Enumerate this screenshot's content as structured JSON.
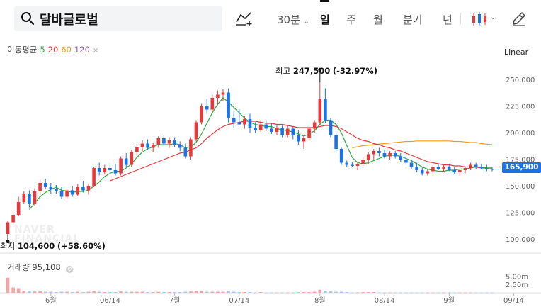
{
  "search": {
    "query": "달바글로벌"
  },
  "periods": [
    {
      "label": "30분",
      "has_dropdown": true
    },
    {
      "label": "일",
      "active": true
    },
    {
      "label": "주"
    },
    {
      "label": "월"
    },
    {
      "label": "분기"
    },
    {
      "label": "년"
    }
  ],
  "toolbar": {
    "dropdown_chevron": "⌄"
  },
  "ma_legend": {
    "title": "이동평균",
    "p5": "5",
    "p20": "20",
    "p60": "60",
    "p120": "120",
    "close": "×"
  },
  "colors": {
    "ma5": "#2eaa3c",
    "ma20": "#e8383b",
    "ma60": "#f39c12",
    "ma120": "#9b59b6",
    "up": "#e8383b",
    "down": "#1a73e8"
  },
  "scale_mode": "Linear",
  "annotations": {
    "high_prefix": "최고",
    "high_value": "247,500",
    "high_change": "(-32.97%)",
    "low_prefix": "최저",
    "low_value": "104,600",
    "low_change": "(+58.60%)"
  },
  "current_price": "165,900",
  "watermark": {
    "line1": "NAVER",
    "line2": "FINANCIAL"
  },
  "volume": {
    "title": "거래량",
    "value": "95,108",
    "gear": "⚙"
  },
  "chart_data": {
    "type": "candlestick",
    "y_ticks": [
      "250,000",
      "225,000",
      "200,000",
      "175,000",
      "150,000",
      "125,000",
      "100,000"
    ],
    "y_tick_values": [
      250000,
      225000,
      200000,
      175000,
      150000,
      125000,
      100000
    ],
    "ylim": [
      87000,
      265000
    ],
    "volume_ticks": [
      "5.00m",
      "2.50m"
    ],
    "volume_tick_values": [
      5.0,
      2.5
    ],
    "vol_max": 5.6,
    "x_labels": [
      "6월",
      "06/14",
      "7월",
      "07/14",
      "8월",
      "08/14",
      "9월",
      "09/14"
    ],
    "x_label_index": [
      8,
      19,
      31,
      43,
      58,
      70,
      82,
      94
    ],
    "high": 247500,
    "low": 104600,
    "last": 165900,
    "ohlc": [
      [
        105000,
        117000,
        104600,
        116000,
        4.6
      ],
      [
        116000,
        125000,
        115000,
        123000,
        1.6
      ],
      [
        123000,
        140000,
        122000,
        135000,
        1.4
      ],
      [
        135000,
        145000,
        133000,
        143000,
        0.6
      ],
      [
        143000,
        146000,
        130000,
        133000,
        0.6
      ],
      [
        133000,
        148000,
        131000,
        145000,
        0.4
      ],
      [
        145000,
        156000,
        143000,
        153000,
        0.4
      ],
      [
        153000,
        157000,
        147000,
        149000,
        0.3
      ],
      [
        149000,
        153000,
        143000,
        147000,
        0.3
      ],
      [
        147000,
        151000,
        143000,
        145000,
        0.2
      ],
      [
        145000,
        149000,
        138000,
        140000,
        0.3
      ],
      [
        140000,
        148000,
        138000,
        146000,
        0.3
      ],
      [
        146000,
        150000,
        140000,
        142000,
        0.2
      ],
      [
        142000,
        152000,
        141000,
        149000,
        0.3
      ],
      [
        149000,
        155000,
        144000,
        146000,
        0.2
      ],
      [
        146000,
        152000,
        142000,
        150000,
        0.3
      ],
      [
        150000,
        168000,
        149000,
        167000,
        0.6
      ],
      [
        167000,
        172000,
        160000,
        163000,
        0.3
      ],
      [
        163000,
        170000,
        161000,
        167000,
        0.2
      ],
      [
        167000,
        172000,
        162000,
        165000,
        0.2
      ],
      [
        165000,
        171000,
        160000,
        162000,
        0.2
      ],
      [
        162000,
        178000,
        160000,
        176000,
        0.4
      ],
      [
        176000,
        181000,
        168000,
        170000,
        0.3
      ],
      [
        170000,
        184000,
        168000,
        182000,
        0.3
      ],
      [
        182000,
        189000,
        178000,
        187000,
        0.3
      ],
      [
        187000,
        193000,
        183000,
        190000,
        0.3
      ],
      [
        190000,
        194000,
        184000,
        186000,
        0.2
      ],
      [
        186000,
        191000,
        182000,
        189000,
        0.2
      ],
      [
        189000,
        197000,
        186000,
        195000,
        0.3
      ],
      [
        195000,
        198000,
        188000,
        190000,
        0.2
      ],
      [
        190000,
        196000,
        186000,
        193000,
        0.2
      ],
      [
        193000,
        196000,
        187000,
        189000,
        0.2
      ],
      [
        189000,
        192000,
        183000,
        186000,
        0.2
      ],
      [
        186000,
        190000,
        176000,
        178000,
        0.3
      ],
      [
        178000,
        196000,
        175000,
        194000,
        0.4
      ],
      [
        194000,
        212000,
        192000,
        210000,
        0.6
      ],
      [
        210000,
        228000,
        208000,
        225000,
        0.5
      ],
      [
        225000,
        232000,
        218000,
        222000,
        0.3
      ],
      [
        222000,
        236000,
        220000,
        233000,
        0.3
      ],
      [
        233000,
        240000,
        226000,
        236000,
        0.3
      ],
      [
        236000,
        241000,
        230000,
        238000,
        0.3
      ],
      [
        238000,
        242000,
        210000,
        214000,
        0.5
      ],
      [
        214000,
        220000,
        205000,
        210000,
        0.3
      ],
      [
        210000,
        222000,
        207000,
        208000,
        0.2
      ],
      [
        208000,
        216000,
        204000,
        213000,
        0.2
      ],
      [
        213000,
        218000,
        200000,
        205000,
        0.2
      ],
      [
        205000,
        210000,
        200000,
        203000,
        0.1
      ],
      [
        203000,
        212000,
        201000,
        208000,
        0.2
      ],
      [
        208000,
        212000,
        202000,
        204000,
        0.1
      ],
      [
        204000,
        209000,
        199000,
        201000,
        0.1
      ],
      [
        201000,
        207000,
        198000,
        205000,
        0.1
      ],
      [
        205000,
        208000,
        196000,
        198000,
        0.1
      ],
      [
        198000,
        207000,
        196000,
        204000,
        0.1
      ],
      [
        204000,
        206000,
        194000,
        198000,
        0.1
      ],
      [
        198000,
        203000,
        189000,
        192000,
        0.2
      ],
      [
        192000,
        198000,
        185000,
        195000,
        0.2
      ],
      [
        195000,
        206000,
        193000,
        204000,
        0.2
      ],
      [
        204000,
        212000,
        200000,
        210000,
        0.3
      ],
      [
        210000,
        247500,
        207000,
        232000,
        0.9
      ],
      [
        232000,
        242000,
        209000,
        212000,
        0.6
      ],
      [
        212000,
        214000,
        196000,
        198000,
        0.4
      ],
      [
        198000,
        200000,
        182000,
        185000,
        0.3
      ],
      [
        185000,
        186000,
        170000,
        172000,
        0.3
      ],
      [
        172000,
        174000,
        168000,
        170000,
        0.2
      ],
      [
        170000,
        173000,
        168000,
        169000,
        0.1
      ],
      [
        169000,
        173000,
        165000,
        171000,
        0.1
      ],
      [
        171000,
        178000,
        169000,
        175000,
        0.2
      ],
      [
        175000,
        182000,
        171000,
        180000,
        0.2
      ],
      [
        180000,
        185000,
        175000,
        183000,
        0.2
      ],
      [
        183000,
        186000,
        178000,
        181000,
        0.1
      ],
      [
        181000,
        184000,
        176000,
        178000,
        0.1
      ],
      [
        178000,
        183000,
        175000,
        181000,
        0.1
      ],
      [
        181000,
        183000,
        176000,
        178000,
        0.1
      ],
      [
        178000,
        181000,
        173000,
        175000,
        0.1
      ],
      [
        175000,
        178000,
        170000,
        172000,
        0.1
      ],
      [
        172000,
        175000,
        166000,
        168000,
        0.1
      ],
      [
        168000,
        172000,
        163000,
        165000,
        0.1
      ],
      [
        165000,
        168000,
        160000,
        162000,
        0.1
      ],
      [
        162000,
        166000,
        160000,
        164000,
        0.1
      ],
      [
        164000,
        170000,
        162000,
        168000,
        0.1
      ],
      [
        168000,
        171000,
        165000,
        166000,
        0.1
      ],
      [
        166000,
        170000,
        163000,
        168000,
        0.1
      ],
      [
        168000,
        171000,
        164000,
        165000,
        0.1
      ],
      [
        165000,
        168000,
        161000,
        163000,
        0.1
      ],
      [
        163000,
        167000,
        160000,
        165000,
        0.1
      ],
      [
        165000,
        168000,
        162000,
        167000,
        0.1
      ],
      [
        167000,
        172000,
        165000,
        170000,
        0.1
      ],
      [
        170000,
        172000,
        166000,
        168000,
        0.1
      ],
      [
        168000,
        171000,
        166000,
        167000,
        0.1
      ],
      [
        167000,
        170000,
        164000,
        166000,
        0.1
      ],
      [
        166000,
        168000,
        164000,
        165900,
        0.1
      ]
    ],
    "ma5": [
      null,
      null,
      null,
      null,
      128000,
      134000,
      140000,
      144000,
      147000,
      149000,
      146000,
      145500,
      144000,
      145000,
      145000,
      146000,
      150000,
      154000,
      159000,
      162000,
      164000,
      164000,
      167000,
      171000,
      177000,
      182000,
      185000,
      187000,
      189000,
      189000,
      189000,
      190000,
      189000,
      186000,
      187000,
      191000,
      199000,
      209000,
      219000,
      227000,
      233000,
      229000,
      224000,
      219000,
      214000,
      210000,
      208000,
      207000,
      206000,
      206000,
      204000,
      203000,
      202000,
      201000,
      199000,
      197000,
      199000,
      202000,
      208000,
      212000,
      212000,
      208000,
      200000,
      188000,
      177000,
      172000,
      171000,
      172000,
      174000,
      176000,
      178000,
      179000,
      179000,
      178000,
      176000,
      174000,
      171000,
      168000,
      166000,
      165000,
      164000,
      164000,
      165000,
      165000,
      166000,
      166000,
      167000,
      168000,
      168000,
      167000,
      167000
    ],
    "ma20": [
      null,
      null,
      null,
      null,
      null,
      null,
      null,
      null,
      null,
      null,
      null,
      null,
      null,
      null,
      null,
      null,
      null,
      null,
      null,
      155000,
      157000,
      159000,
      161000,
      163000,
      165000,
      167000,
      169000,
      171000,
      173000,
      175000,
      177000,
      179000,
      181000,
      182000,
      184000,
      186000,
      190000,
      195000,
      199000,
      203000,
      206000,
      208000,
      209000,
      210000,
      211000,
      211000,
      211000,
      210000,
      209000,
      209000,
      208000,
      208000,
      207000,
      206000,
      205000,
      205000,
      205000,
      205000,
      206000,
      207000,
      207000,
      206000,
      204000,
      201000,
      198000,
      195000,
      193000,
      192000,
      190000,
      189000,
      187000,
      186000,
      184000,
      183000,
      181000,
      179000,
      177000,
      175000,
      173000,
      172000,
      171000,
      170000,
      170000,
      169000,
      169000,
      168000,
      168000,
      168000,
      167000,
      167000,
      167000
    ],
    "ma60": [
      null,
      null,
      null,
      null,
      null,
      null,
      null,
      null,
      null,
      null,
      null,
      null,
      null,
      null,
      null,
      null,
      null,
      null,
      null,
      null,
      null,
      null,
      null,
      null,
      null,
      null,
      null,
      null,
      null,
      null,
      null,
      null,
      null,
      null,
      null,
      null,
      null,
      null,
      null,
      null,
      null,
      null,
      null,
      null,
      null,
      null,
      null,
      null,
      null,
      null,
      null,
      null,
      null,
      null,
      null,
      null,
      null,
      null,
      null,
      null,
      null,
      null,
      null,
      null,
      186000,
      187000,
      188000,
      188500,
      189000,
      189500,
      190000,
      190500,
      191000,
      191500,
      192000,
      192000,
      192500,
      192500,
      192500,
      192500,
      192500,
      192500,
      192500,
      192000,
      192000,
      191500,
      191000,
      191000,
      190000,
      189500,
      189000
    ]
  }
}
